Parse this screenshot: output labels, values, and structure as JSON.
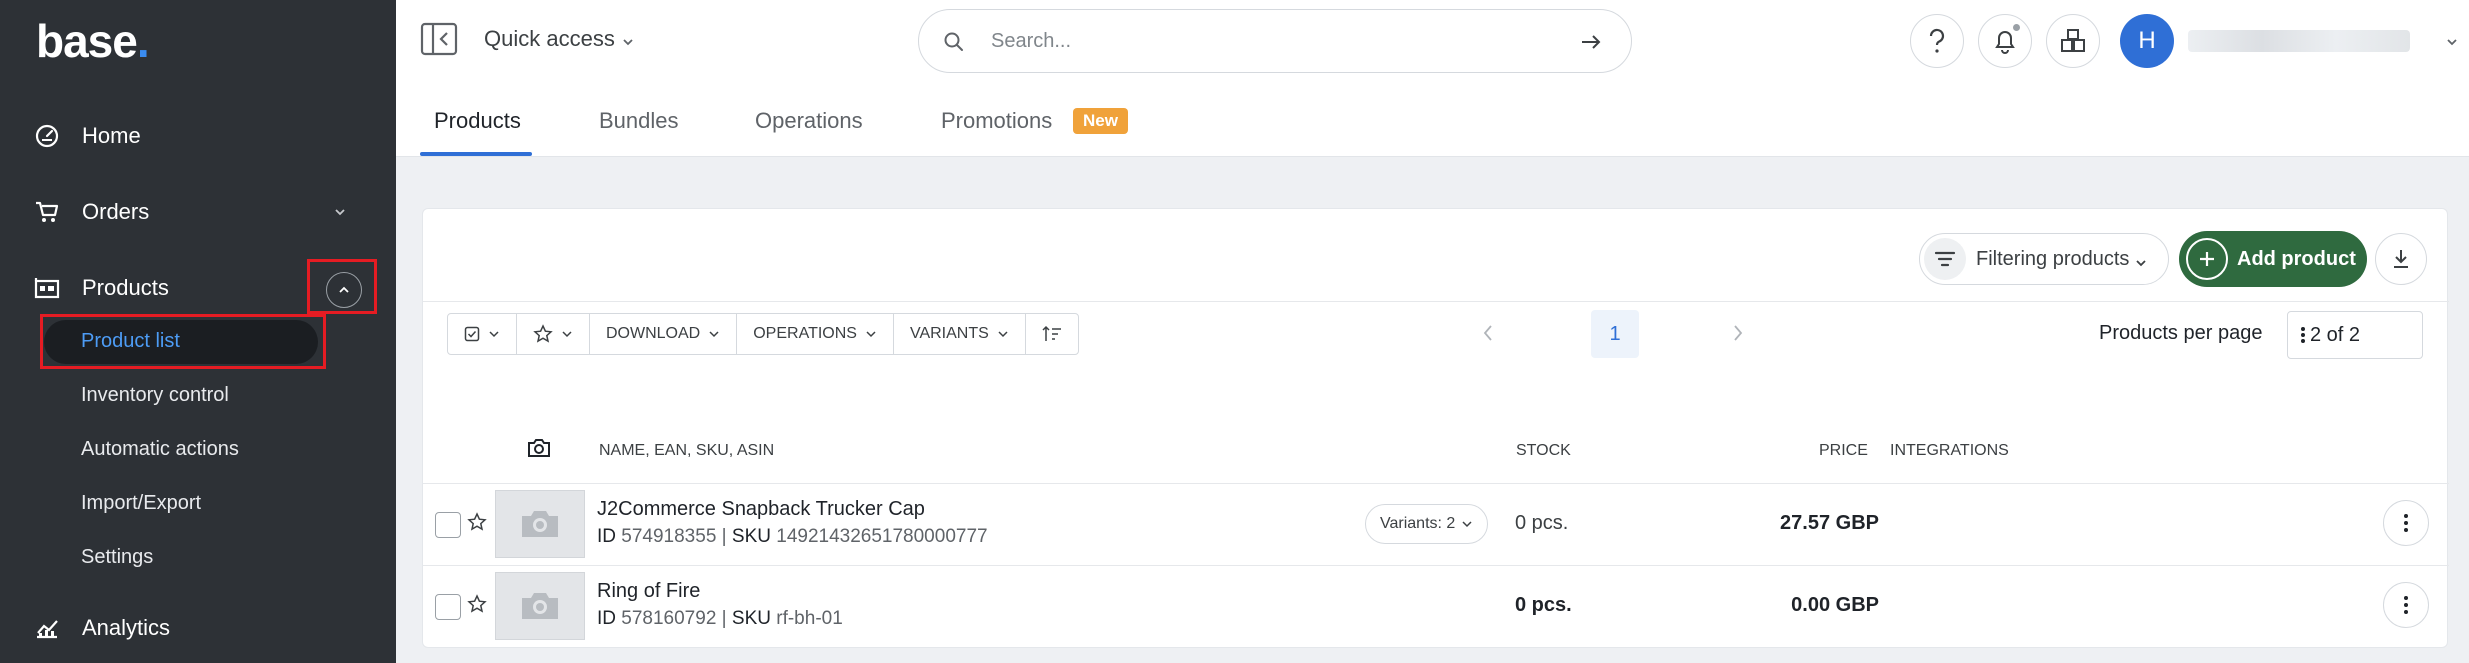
{
  "sidebar": {
    "logo_text": "base",
    "logo_dot": ".",
    "items": [
      {
        "label": "Home",
        "icon": "gauge-icon"
      },
      {
        "label": "Orders",
        "icon": "cart-icon"
      },
      {
        "label": "Products",
        "icon": "products-icon"
      },
      {
        "label": "Analytics",
        "icon": "analytics-icon"
      }
    ],
    "products_sub": [
      "Product list",
      "Inventory control",
      "Automatic actions",
      "Import/Export",
      "Settings"
    ]
  },
  "header": {
    "quick_access": "Quick access",
    "search_placeholder": "Search...",
    "avatar_initial": "H",
    "tabs": [
      "Products",
      "Bundles",
      "Operations",
      "Promotions"
    ],
    "new_badge": "New"
  },
  "toolbar": {
    "filter_label": "Filtering products",
    "add_product_label": "Add product",
    "download": "DOWNLOAD",
    "operations": "OPERATIONS",
    "variants": "VARIANTS",
    "current_page": "1",
    "per_page_label": "Products per page",
    "per_page_value": "2 of 2"
  },
  "table": {
    "headers": {
      "name": "NAME, EAN, SKU, ASIN",
      "stock": "STOCK",
      "price": "PRICE",
      "integrations": "INTEGRATIONS"
    },
    "rows": [
      {
        "name": "J2Commerce Snapback Trucker Cap",
        "id_label": "ID",
        "id": "574918355",
        "sku_label": "SKU",
        "sku": "14921432651780000777",
        "variants": "Variants: 2",
        "stock": "0 pcs.",
        "price": "27.57 GBP"
      },
      {
        "name": "Ring of Fire",
        "id_label": "ID",
        "id": "578160792",
        "sku_label": "SKU",
        "sku": "rf-bh-01",
        "stock": "0 pcs.",
        "price": "0.00 GBP"
      }
    ]
  },
  "colors": {
    "sidebar_bg": "#2d3136",
    "accent": "#2f6fd6",
    "add_button": "#2f6a3f",
    "highlight": "#e51c23",
    "badge": "#f0a23a"
  }
}
